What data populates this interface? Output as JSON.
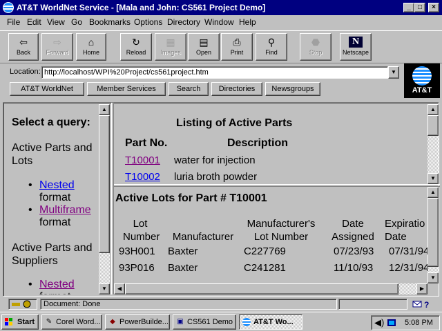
{
  "window": {
    "title": "AT&T WorldNet Service - [Mala and John: CS561 Project Demo]",
    "minimize_glyph": "_",
    "maximize_glyph": "□",
    "close_glyph": "×"
  },
  "menu": {
    "items": [
      "File",
      "Edit",
      "View",
      "Go",
      "Bookmarks",
      "Options",
      "Directory",
      "Window",
      "Help"
    ]
  },
  "toolbar": {
    "buttons": [
      {
        "label": "Back",
        "icon": "back-arrow-icon",
        "glyph": "⇦"
      },
      {
        "label": "Forward",
        "icon": "forward-arrow-icon",
        "glyph": "⇨"
      },
      {
        "label": "Home",
        "icon": "home-icon",
        "glyph": "⌂"
      },
      {
        "label": "Reload",
        "icon": "reload-icon",
        "glyph": "↻"
      },
      {
        "label": "Images",
        "icon": "images-icon",
        "glyph": "▦"
      },
      {
        "label": "Open",
        "icon": "open-icon",
        "glyph": "▤"
      },
      {
        "label": "Print",
        "icon": "print-icon",
        "glyph": "⎙"
      },
      {
        "label": "Find",
        "icon": "find-icon",
        "glyph": "⚲"
      },
      {
        "label": "Stop",
        "icon": "stop-icon",
        "glyph": "⬣"
      },
      {
        "label": "Netscape",
        "icon": "netscape-icon",
        "glyph": "N"
      }
    ]
  },
  "location": {
    "label": "Location:",
    "url": "http://localhost/WPI%20Project/cs561project.htm",
    "dropdown_glyph": "▼"
  },
  "directory_buttons": [
    "AT&T WorldNet",
    "Member Services",
    "Search",
    "Directories",
    "Newsgroups"
  ],
  "logo": {
    "text": "AT&T"
  },
  "left_frame": {
    "heading": "Select a query:",
    "section1": "Active Parts and Lots",
    "section1_links": [
      {
        "link": "Nested",
        "suffix": "format"
      },
      {
        "link": "Multiframe",
        "suffix": "format"
      }
    ],
    "section2": "Active Parts and Suppliers",
    "section2_links": [
      {
        "link": "Nested",
        "suffix": "format"
      }
    ],
    "bullet": "•"
  },
  "parts_frame": {
    "title": "Listing of Active Parts",
    "col_part": "Part No.",
    "col_desc": "Description",
    "rows": [
      {
        "part": "T10001",
        "desc": "water for injection"
      },
      {
        "part": "T10002",
        "desc": "luria broth powder"
      }
    ]
  },
  "lots_frame": {
    "title": "Active Lots for Part # T10001",
    "headers": [
      "Lot Number",
      "Manufacturer",
      "Manufacturer's Lot Number",
      "Date Assigned",
      "Expiratio Date"
    ],
    "rows": [
      [
        "93H001",
        "Baxter",
        "C227769",
        "07/23/93",
        "07/31/94"
      ],
      [
        "93P016",
        "Baxter",
        "C241281",
        "11/10/93",
        "12/31/94"
      ]
    ]
  },
  "scroll_glyphs": {
    "up": "▲",
    "down": "▼",
    "left": "◀",
    "right": "▶"
  },
  "status": {
    "text": "Document: Done"
  },
  "taskbar": {
    "start": "Start",
    "tasks": [
      {
        "label": "Corel Word...",
        "icon": "corel-icon"
      },
      {
        "label": "PowerBuilde...",
        "icon": "powerbuilder-icon"
      },
      {
        "label": "CS561 Demo",
        "icon": "demo-icon"
      },
      {
        "label": "AT&T Wo...",
        "icon": "att-icon",
        "active": true
      }
    ],
    "clock": "5:08 PM"
  },
  "colors": {
    "titlebar": "#000080",
    "link": "#0000ee",
    "visited": "#800080",
    "face": "#c0c0c0"
  }
}
